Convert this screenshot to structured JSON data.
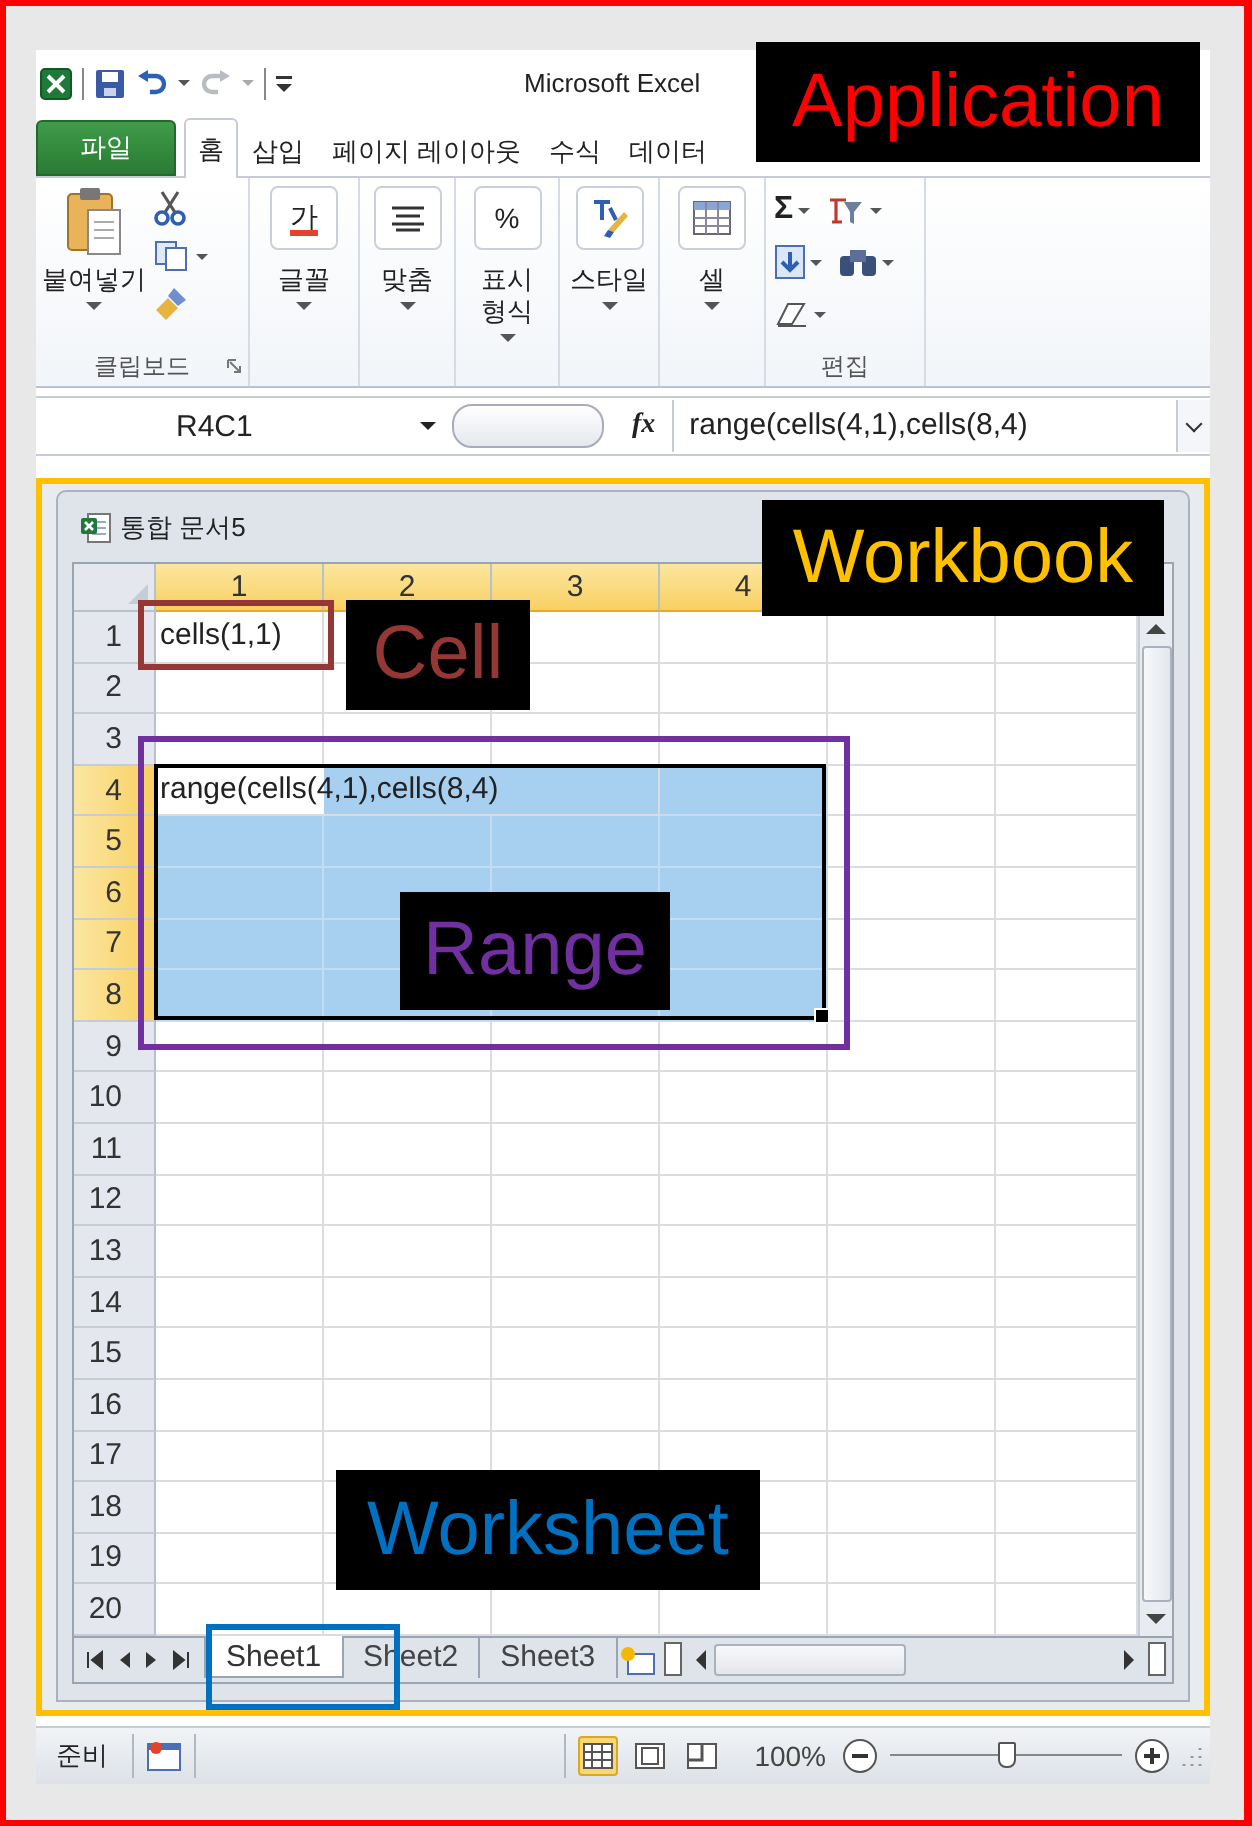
{
  "window": {
    "title": "Microsoft Excel"
  },
  "ribbon_tabs": [
    {
      "label": "파일",
      "kind": "file",
      "selected": false
    },
    {
      "label": "홈",
      "kind": "tab",
      "selected": true
    },
    {
      "label": "삽입",
      "kind": "tab",
      "selected": false
    },
    {
      "label": "페이지 레이아웃",
      "kind": "tab",
      "selected": false
    },
    {
      "label": "수식",
      "kind": "tab",
      "selected": false
    },
    {
      "label": "데이터",
      "kind": "tab",
      "selected": false
    }
  ],
  "ribbon_groups": [
    {
      "kind": "clipboard",
      "label": "클립보드",
      "button": "붙여넣기"
    },
    {
      "kind": "font",
      "button": "글꼴",
      "glyph": "가"
    },
    {
      "kind": "alignment",
      "button": "맞춤"
    },
    {
      "kind": "number",
      "button": "표시 형식",
      "glyph": "%"
    },
    {
      "kind": "styles",
      "button": "스타일"
    },
    {
      "kind": "cells",
      "button": "셀"
    },
    {
      "kind": "editing",
      "label": "편집",
      "glyph": "Σ"
    }
  ],
  "formula_bar": {
    "name_box": "R4C1",
    "function_label": "fx",
    "formula": "range(cells(4,1),cells(8,4)"
  },
  "workbook": {
    "title": "통합 문서5",
    "columns": [
      {
        "label": "1",
        "selected": true
      },
      {
        "label": "2",
        "selected": true
      },
      {
        "label": "3",
        "selected": true
      },
      {
        "label": "4",
        "selected": true
      }
    ],
    "rows": [
      {
        "label": "1",
        "selected": false,
        "text": "cells(1,1)"
      },
      {
        "label": "2",
        "selected": false
      },
      {
        "label": "3",
        "selected": false
      },
      {
        "label": "4",
        "selected": true,
        "text": "range(cells(4,1),cells(8,4)"
      },
      {
        "label": "5",
        "selected": true
      },
      {
        "label": "6",
        "selected": true
      },
      {
        "label": "7",
        "selected": true
      },
      {
        "label": "8",
        "selected": true
      },
      {
        "label": "9",
        "selected": false
      },
      {
        "label": "10",
        "selected": false
      },
      {
        "label": "11",
        "selected": false
      },
      {
        "label": "12",
        "selected": false
      },
      {
        "label": "13",
        "selected": false
      },
      {
        "label": "14",
        "selected": false
      },
      {
        "label": "15",
        "selected": false
      },
      {
        "label": "16",
        "selected": false
      },
      {
        "label": "17",
        "selected": false
      },
      {
        "label": "18",
        "selected": false
      },
      {
        "label": "19",
        "selected": false
      },
      {
        "label": "20",
        "selected": false
      }
    ],
    "sheets": [
      {
        "label": "Sheet1",
        "selected": true
      },
      {
        "label": "Sheet2",
        "selected": false
      },
      {
        "label": "Sheet3",
        "selected": false
      }
    ]
  },
  "status_bar": {
    "text": "준비",
    "views": [
      {
        "kind": "normal",
        "selected": true
      },
      {
        "kind": "page_layout",
        "selected": false
      },
      {
        "kind": "page_break",
        "selected": false
      }
    ],
    "zoom": "100%",
    "level": 0.5
  },
  "annotations": [
    {
      "kind": "application",
      "label": "Application",
      "color": "#ff0000"
    },
    {
      "kind": "workbook",
      "label": "Workbook",
      "color": "#ffc000"
    },
    {
      "kind": "cell",
      "label": "Cell",
      "color": "#953735"
    },
    {
      "kind": "range",
      "label": "Range",
      "color": "#7030a0"
    },
    {
      "kind": "worksheet",
      "label": "Worksheet",
      "color": "#0070c0"
    }
  ]
}
